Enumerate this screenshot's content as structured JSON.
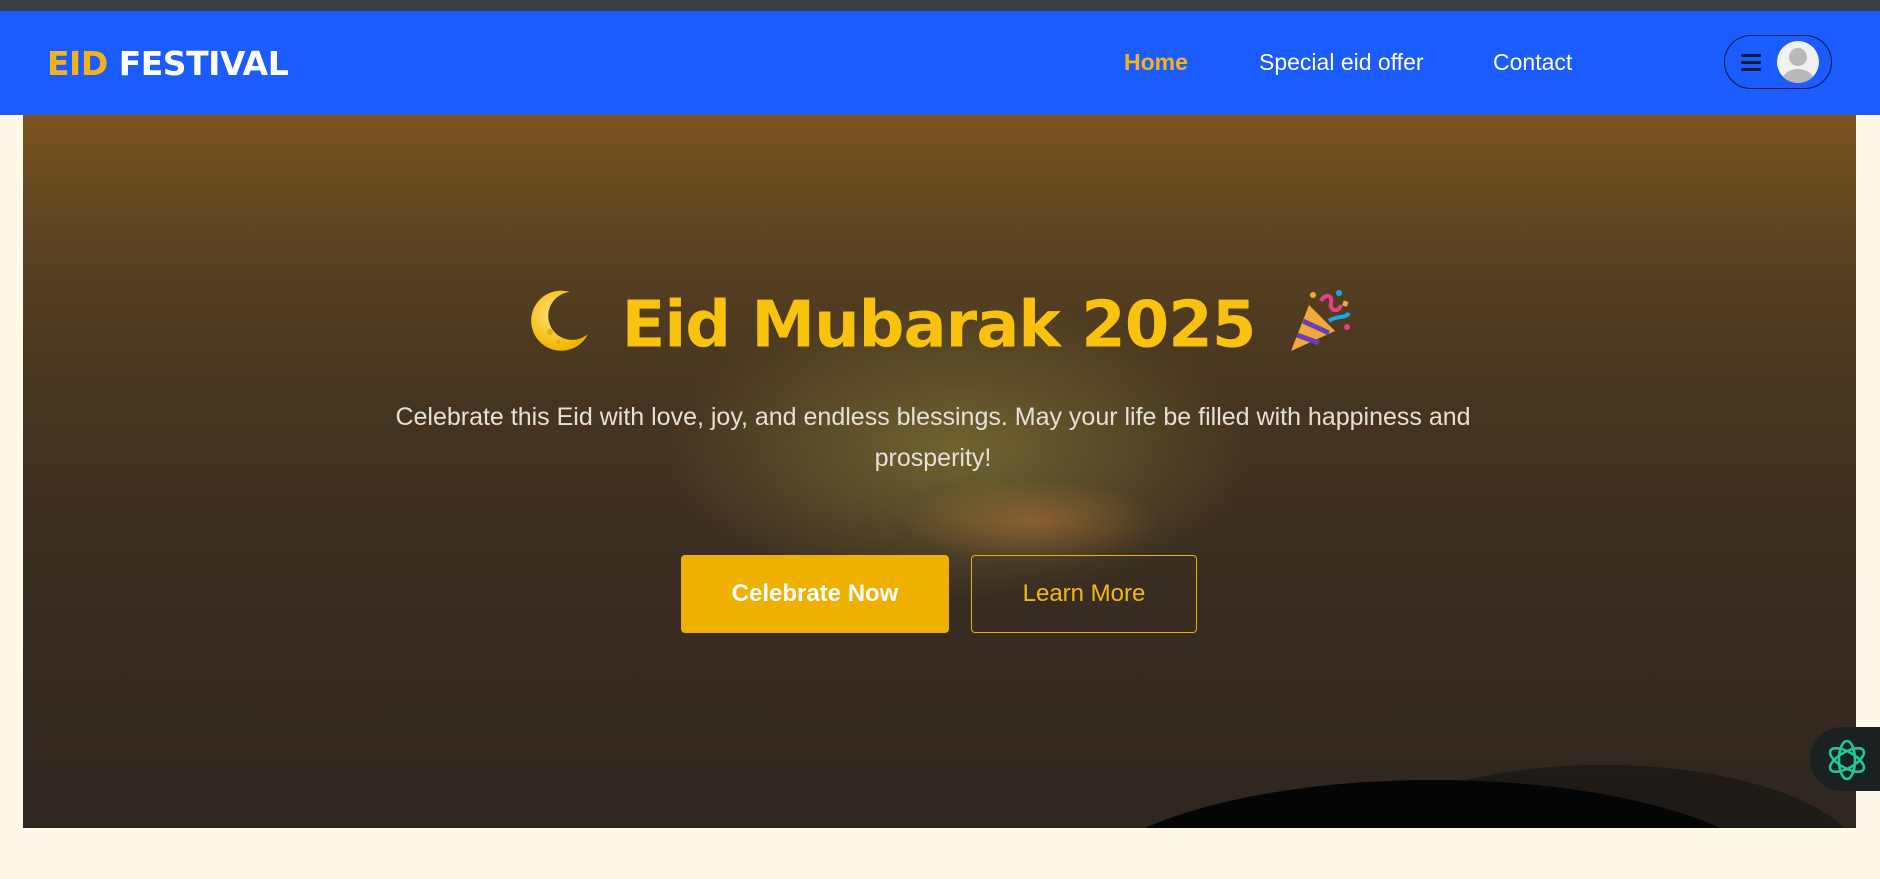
{
  "browser": {
    "top_strip_color": "#3b3e45"
  },
  "header": {
    "brand": {
      "accent": "EID",
      "rest": "FESTIVAL"
    },
    "nav": [
      {
        "label": "Home",
        "active": true
      },
      {
        "label": "Special eid offer",
        "active": false
      },
      {
        "label": "Contact",
        "active": false
      }
    ],
    "user_menu": {
      "menu_icon": "hamburger-icon",
      "avatar_icon": "user-avatar-icon"
    }
  },
  "hero": {
    "title": "Eid Mubarak 2025",
    "title_prefix_emoji": "🌙",
    "title_suffix_emoji": "🎉",
    "subtitle": "Celebrate this Eid with love, joy, and endless blessings. May your life be filled with happiness and prosperity!",
    "primary_button": "Celebrate Now",
    "secondary_button": "Learn More"
  },
  "assistant": {
    "icon": "openai-logo-icon"
  },
  "colors": {
    "nav_bg": "#1a5cff",
    "accent_gold": "#f5b21b",
    "headline": "#f9c20e",
    "page_bg": "#fdf9e6"
  }
}
